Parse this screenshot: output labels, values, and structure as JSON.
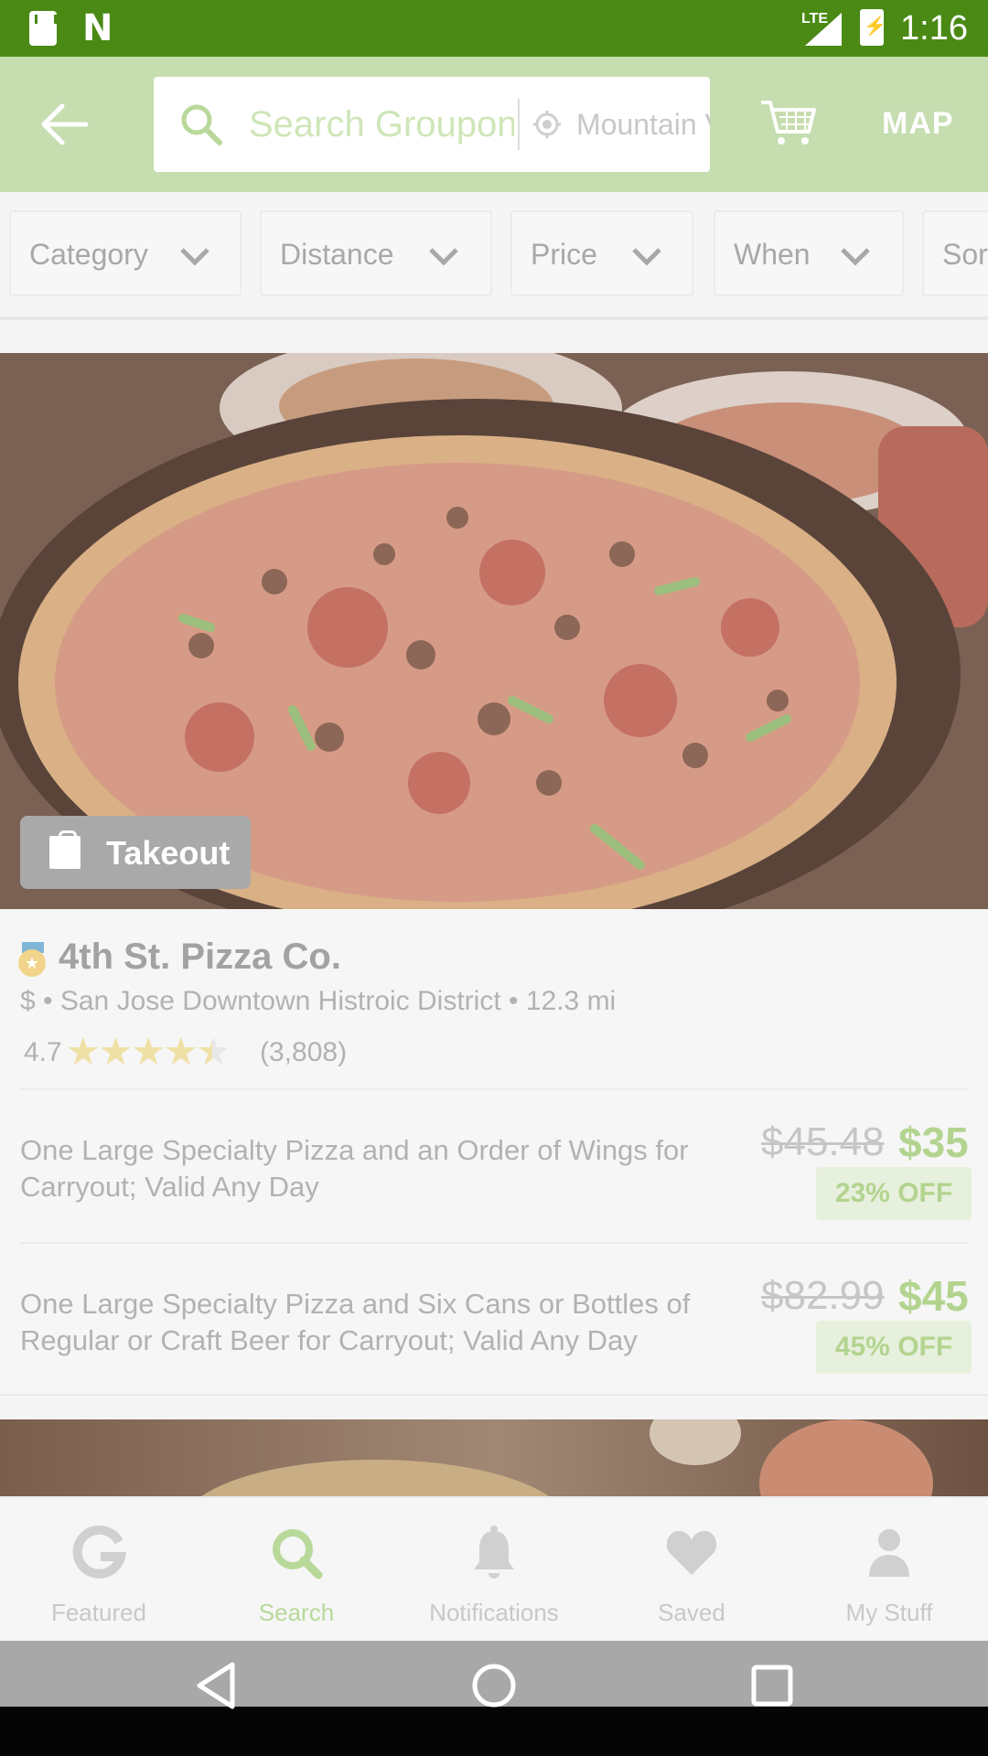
{
  "status_bar": {
    "time": "1:16",
    "network": "LTE"
  },
  "header": {
    "search_placeholder": "Search Groupon",
    "location": "Mountain View",
    "map_label": "MAP",
    "icons": [
      "back-arrow-icon",
      "search-icon",
      "location-icon",
      "cart-icon"
    ]
  },
  "filters": [
    {
      "label": "Category"
    },
    {
      "label": "Distance"
    },
    {
      "label": "Price"
    },
    {
      "label": "When"
    },
    {
      "label": "Sort"
    }
  ],
  "deal_card": {
    "badge": "Takeout",
    "merchant": "4th St. Pizza Co.",
    "meta": "$ • San Jose Downtown Histroic District • 12.3 mi",
    "rating": "4.7",
    "rating_stars": 4.5,
    "rating_count": "(3,808)",
    "options": [
      {
        "title": "One Large Specialty Pizza and an Order of Wings for Carryout; Valid Any Day",
        "old_price": "$45.48",
        "new_price": "$35",
        "discount": "23% OFF"
      },
      {
        "title": "One Large Specialty Pizza and Six Cans or Bottles of Regular or Craft Beer for Carryout; Valid Any Day",
        "old_price": "$82.99",
        "new_price": "$45",
        "discount": "45% OFF"
      }
    ]
  },
  "bottom_nav": [
    {
      "label": "Featured",
      "icon": "groupon-g-icon",
      "active": false
    },
    {
      "label": "Search",
      "icon": "search-icon",
      "active": true
    },
    {
      "label": "Notifications",
      "icon": "bell-icon",
      "active": false
    },
    {
      "label": "Saved",
      "icon": "heart-icon",
      "active": false
    },
    {
      "label": "My Stuff",
      "icon": "person-icon",
      "active": false
    }
  ],
  "colors": {
    "status_bar": "#4a8a14",
    "app_bar": "#c6ddb0",
    "accent": "#b3d48f"
  }
}
